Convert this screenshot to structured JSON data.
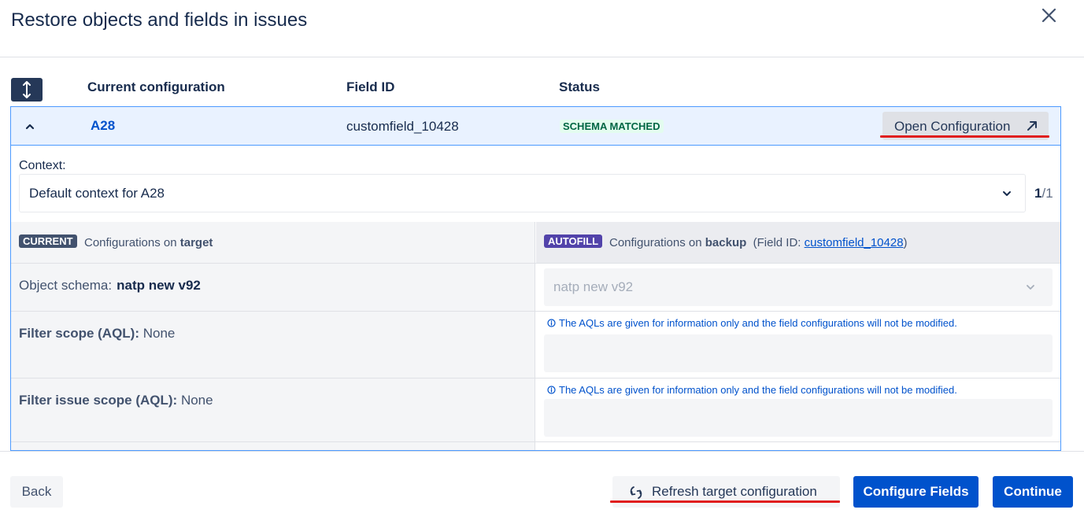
{
  "dialog": {
    "title": "Restore objects and fields in issues"
  },
  "table": {
    "columns": {
      "config": "Current configuration",
      "field_id": "Field ID",
      "status": "Status"
    },
    "row": {
      "name": "A28",
      "field_id": "customfield_10428",
      "status": "SCHEMA MATCHED",
      "open_button": "Open Configuration"
    }
  },
  "context": {
    "label": "Context:",
    "value": "Default context for A28",
    "pager_current": "1",
    "pager_total": "/1"
  },
  "current": {
    "lozenge": "CURRENT",
    "text_prefix": "Configurations on",
    "text_target": "target"
  },
  "autofill": {
    "lozenge": "AUTOFILL",
    "text_prefix": "Configurations on",
    "text_target": "backup",
    "field_id_prefix": "(Field ID:",
    "field_id_link": "customfield_10428",
    "field_id_suffix": ")"
  },
  "rows": {
    "schema_label": "Object schema:",
    "schema_value": "natp new v92",
    "schema_select_value": "natp new v92",
    "filter_scope_label": "Filter scope (AQL):",
    "filter_scope_value": "None",
    "filter_issue_scope_label": "Filter issue scope (AQL):",
    "filter_issue_scope_value": "None",
    "aql_note": "The AQLs are given for information only and the field configurations will not be modified."
  },
  "footer": {
    "back": "Back",
    "refresh": "Refresh target configuration",
    "configure": "Configure Fields",
    "continue": "Continue"
  },
  "colors": {
    "primary": "#0052cc",
    "status_bg": "#e3fcef",
    "status_text": "#006644",
    "highlight_underline": "#e01e1e",
    "current_lozenge": "#42526e",
    "autofill_lozenge": "#5243aa"
  }
}
